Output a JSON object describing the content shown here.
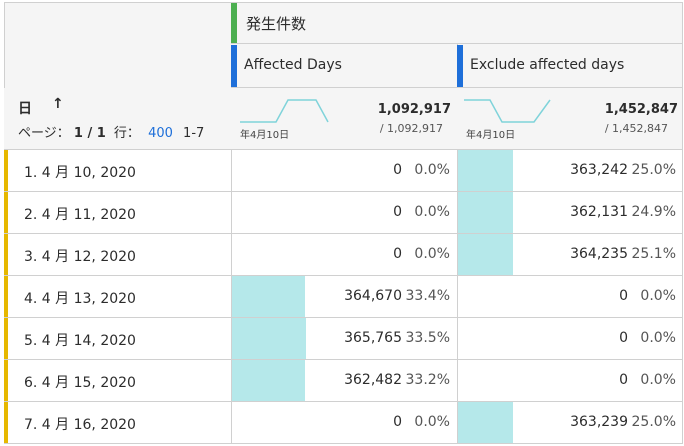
{
  "header": {
    "metric_title": "発生件数",
    "segment1": "Affected Days",
    "segment2": "Exclude affected days"
  },
  "dimension": {
    "title": "日",
    "sort_icon": "arrow-up-icon"
  },
  "pager": {
    "page_label": "ページ：",
    "page_value": "1 / 1",
    "rows_label": "行：",
    "rows_value": "400",
    "range_text": "1-7"
  },
  "totals": {
    "segment1": {
      "total": "1,092,917",
      "sub": "/ 1,092,917",
      "spark_label": "年4月10日"
    },
    "segment2": {
      "total": "1,452,847",
      "sub": "/ 1,452,847",
      "spark_label": "年4月10日"
    }
  },
  "colors": {
    "metric_chip": "#4caf50",
    "segment_chip": "#1e6fd9",
    "row_stripe": "#e6b800",
    "bar": "#b5e8ea",
    "sparkline": "#7fd3da"
  },
  "rows": [
    {
      "label": "1. 4 月 10, 2020",
      "s1_value": "0",
      "s1_pct": "0.0%",
      "s1_share": 0.0,
      "s2_value": "363,242",
      "s2_pct": "25.0%",
      "s2_share": 0.25
    },
    {
      "label": "2. 4 月 11, 2020",
      "s1_value": "0",
      "s1_pct": "0.0%",
      "s1_share": 0.0,
      "s2_value": "362,131",
      "s2_pct": "24.9%",
      "s2_share": 0.249
    },
    {
      "label": "3. 4 月 12, 2020",
      "s1_value": "0",
      "s1_pct": "0.0%",
      "s1_share": 0.0,
      "s2_value": "364,235",
      "s2_pct": "25.1%",
      "s2_share": 0.251
    },
    {
      "label": "4. 4 月 13, 2020",
      "s1_value": "364,670",
      "s1_pct": "33.4%",
      "s1_share": 0.334,
      "s2_value": "0",
      "s2_pct": "0.0%",
      "s2_share": 0.0
    },
    {
      "label": "5. 4 月 14, 2020",
      "s1_value": "365,765",
      "s1_pct": "33.5%",
      "s1_share": 0.335,
      "s2_value": "0",
      "s2_pct": "0.0%",
      "s2_share": 0.0
    },
    {
      "label": "6. 4 月 15, 2020",
      "s1_value": "362,482",
      "s1_pct": "33.2%",
      "s1_share": 0.332,
      "s2_value": "0",
      "s2_pct": "0.0%",
      "s2_share": 0.0
    },
    {
      "label": "7. 4 月 16, 2020",
      "s1_value": "0",
      "s1_pct": "0.0%",
      "s1_share": 0.0,
      "s2_value": "363,239",
      "s2_pct": "25.0%",
      "s2_share": 0.25
    }
  ]
}
